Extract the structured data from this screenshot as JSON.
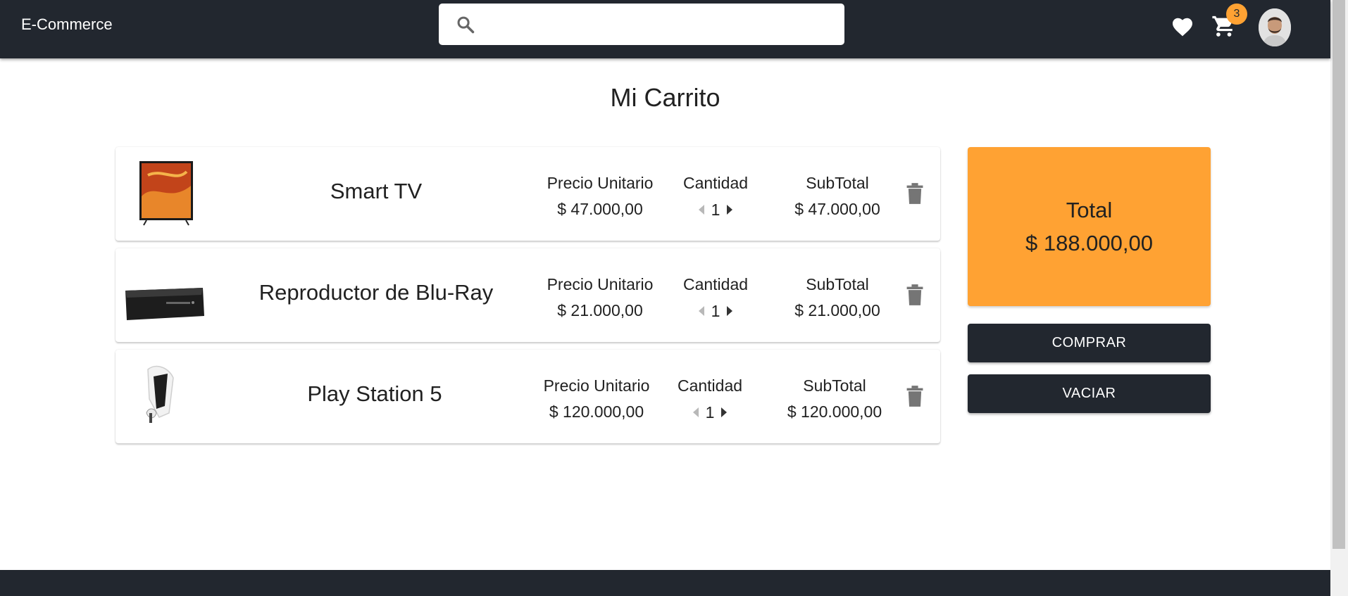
{
  "header": {
    "brand": "E-Commerce",
    "search_placeholder": "",
    "cart_badge": "3",
    "icons": [
      "search-icon",
      "heart-icon",
      "cart-icon",
      "avatar"
    ]
  },
  "page": {
    "title": "Mi Carrito"
  },
  "cart": {
    "columns": {
      "price": "Precio Unitario",
      "qty": "Cantidad",
      "subtotal": "SubTotal"
    },
    "items": [
      {
        "name": "Smart TV",
        "price": "$ 47.000,00",
        "qty": "1",
        "subtotal": "$ 47.000,00"
      },
      {
        "name": "Reproductor de Blu-Ray",
        "price": "$ 21.000,00",
        "qty": "1",
        "subtotal": "$ 21.000,00"
      },
      {
        "name": "Play Station 5",
        "price": "$ 120.000,00",
        "qty": "1",
        "subtotal": "$ 120.000,00"
      }
    ]
  },
  "summary": {
    "total_label": "Total",
    "total_value": "$ 188.000,00",
    "buy_label": "COMPRAR",
    "empty_label": "VACIAR"
  },
  "colors": {
    "header_bg": "#22272f",
    "accent": "#ffa233",
    "button_bg": "#22272f"
  }
}
